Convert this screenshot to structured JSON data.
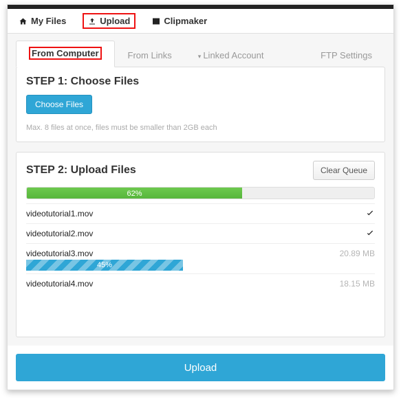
{
  "nav": {
    "my_files": "My Files",
    "upload": "Upload",
    "clipmaker": "Clipmaker"
  },
  "subnav": {
    "from_computer": "From Computer",
    "from_links": "From Links",
    "linked_account": "Linked Account",
    "ftp_settings": "FTP Settings"
  },
  "step1": {
    "title": "STEP 1: Choose Files",
    "choose_btn": "Choose Files",
    "hint": "Max. 8 files at once, files must be smaller than 2GB each"
  },
  "step2": {
    "title": "STEP 2: Upload Files",
    "clear_btn": "Clear Queue",
    "overall_pct": "62%",
    "files": [
      {
        "name": "videotutorial1.mov",
        "status": "done"
      },
      {
        "name": "videotutorial2.mov",
        "status": "done"
      },
      {
        "name": "videotutorial3.mov",
        "status": "uploading",
        "size": "20.89 MB",
        "pct": "45%"
      },
      {
        "name": "videotutorial4.mov",
        "status": "queued",
        "size": "18.15 MB"
      }
    ]
  },
  "upload_btn": "Upload"
}
